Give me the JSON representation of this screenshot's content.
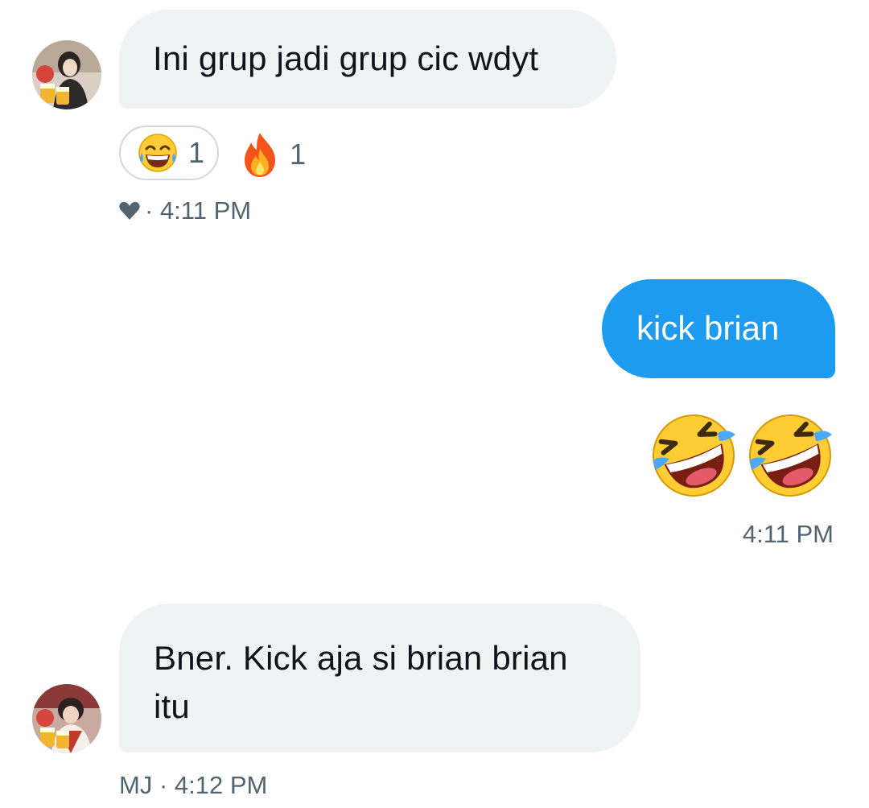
{
  "messages": [
    {
      "text": "Ini grup jadi grup cic wdyt",
      "reactions": [
        {
          "icon": "grinning-sweat-emoji",
          "count": "1"
        },
        {
          "icon": "fire-emoji",
          "count": "1"
        }
      ],
      "meta": {
        "icon": "heart-icon",
        "time": "· 4:11 PM"
      }
    },
    {
      "text": "kick brian",
      "emojis": [
        "rofl-emoji",
        "rofl-emoji"
      ],
      "time": "4:11 PM"
    },
    {
      "text": "Bner. Kick aja si brian brian itu",
      "meta": {
        "sender": "MJ",
        "time": "· 4:12 PM"
      }
    }
  ],
  "colors": {
    "incoming_bubble": "#eff3f4",
    "outgoing_bubble": "#1d9bf0",
    "meta_text": "#536471"
  }
}
